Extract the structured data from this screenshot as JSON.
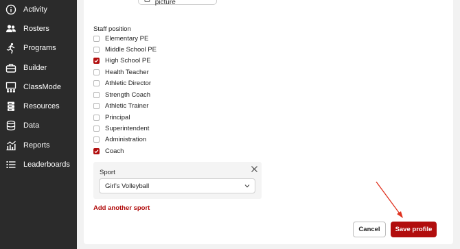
{
  "sidebar": {
    "items": [
      {
        "label": "Activity",
        "icon": "info-circle-icon"
      },
      {
        "label": "Rosters",
        "icon": "users-icon"
      },
      {
        "label": "Programs",
        "icon": "running-person-icon"
      },
      {
        "label": "Builder",
        "icon": "toolbox-icon"
      },
      {
        "label": "ClassMode",
        "icon": "classroom-icon"
      },
      {
        "label": "Resources",
        "icon": "server-icon"
      },
      {
        "label": "Data",
        "icon": "database-icon"
      },
      {
        "label": "Reports",
        "icon": "chart-icon"
      },
      {
        "label": "Leaderboards",
        "icon": "list-icon"
      }
    ]
  },
  "profile": {
    "top_button_label": "Delete profile picture",
    "staff_position_label": "Staff position",
    "positions": [
      {
        "label": "Elementary PE",
        "checked": false
      },
      {
        "label": "Middle School PE",
        "checked": false
      },
      {
        "label": "High School PE",
        "checked": true
      },
      {
        "label": "Health Teacher",
        "checked": false
      },
      {
        "label": "Athletic Director",
        "checked": false
      },
      {
        "label": "Strength Coach",
        "checked": false
      },
      {
        "label": "Athletic Trainer",
        "checked": false
      },
      {
        "label": "Principal",
        "checked": false
      },
      {
        "label": "Superintendent",
        "checked": false
      },
      {
        "label": "Administration",
        "checked": false
      },
      {
        "label": "Coach",
        "checked": true
      }
    ],
    "sport_label": "Sport",
    "sport_value": "Girl’s Volleyball",
    "add_sport_label": "Add another sport",
    "cancel_label": "Cancel",
    "save_label": "Save profile"
  },
  "colors": {
    "accent": "#b10d0d",
    "sidebar_bg": "#2b2b2b",
    "annotation_arrow": "#e0321f"
  }
}
